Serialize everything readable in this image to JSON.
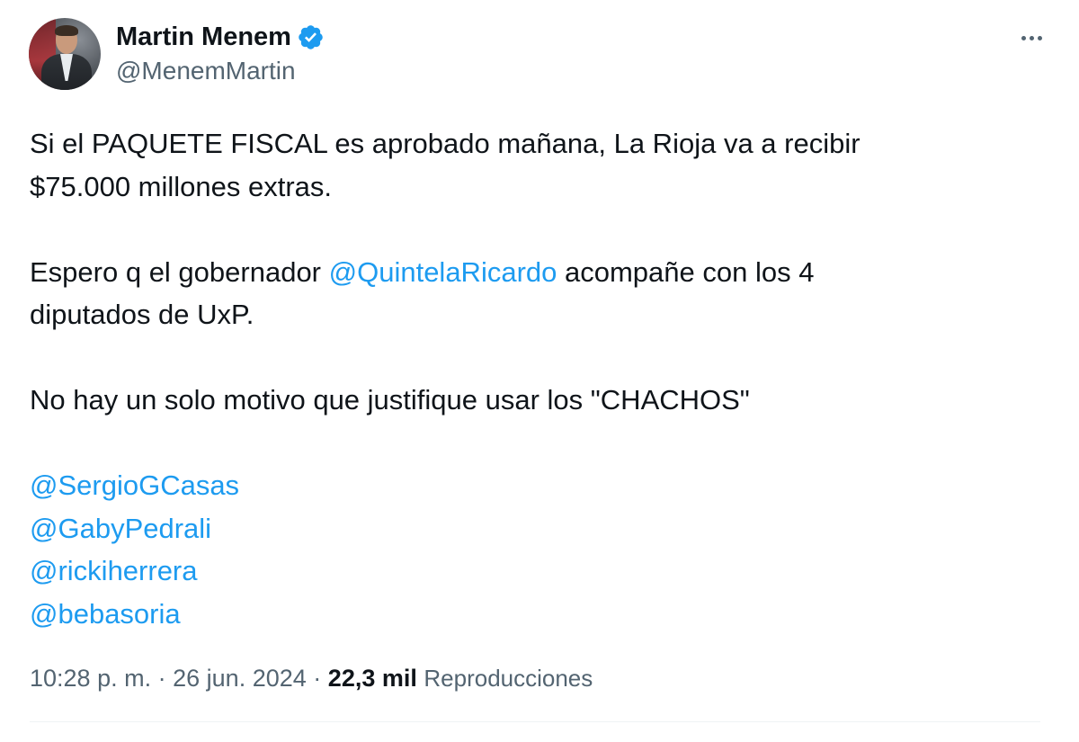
{
  "author": {
    "display_name": "Martin Menem",
    "handle": "@MenemMartin",
    "verified": true
  },
  "tweet": {
    "line1a": "Si el PAQUETE FISCAL es aprobado mañana, La Rioja va a recibir",
    "line1b": "$75.000 millones extras.",
    "line2a_prefix": "Espero q el gobernador ",
    "line2a_mention": "@QuintelaRicardo",
    "line2a_suffix": " acompañe con los 4",
    "line2b": "diputados de UxP.",
    "line3": "No hay un solo motivo que justifique usar los \"CHACHOS\"",
    "mentions": [
      "@SergioGCasas",
      "@GabyPedrali",
      "@rickiherrera",
      "@bebasoria"
    ]
  },
  "meta": {
    "time": "10:28 p. m.",
    "separator": "·",
    "date": "26 jun. 2024",
    "views_count": "22,3 mil",
    "views_label": "Reproducciones"
  },
  "colors": {
    "link": "#1d9bf0",
    "secondary_text": "#536471",
    "primary_text": "#0f1419",
    "verified_badge": "#1d9bf0"
  },
  "icons": {
    "verified": "verified-badge-icon",
    "more": "more-options-icon"
  }
}
